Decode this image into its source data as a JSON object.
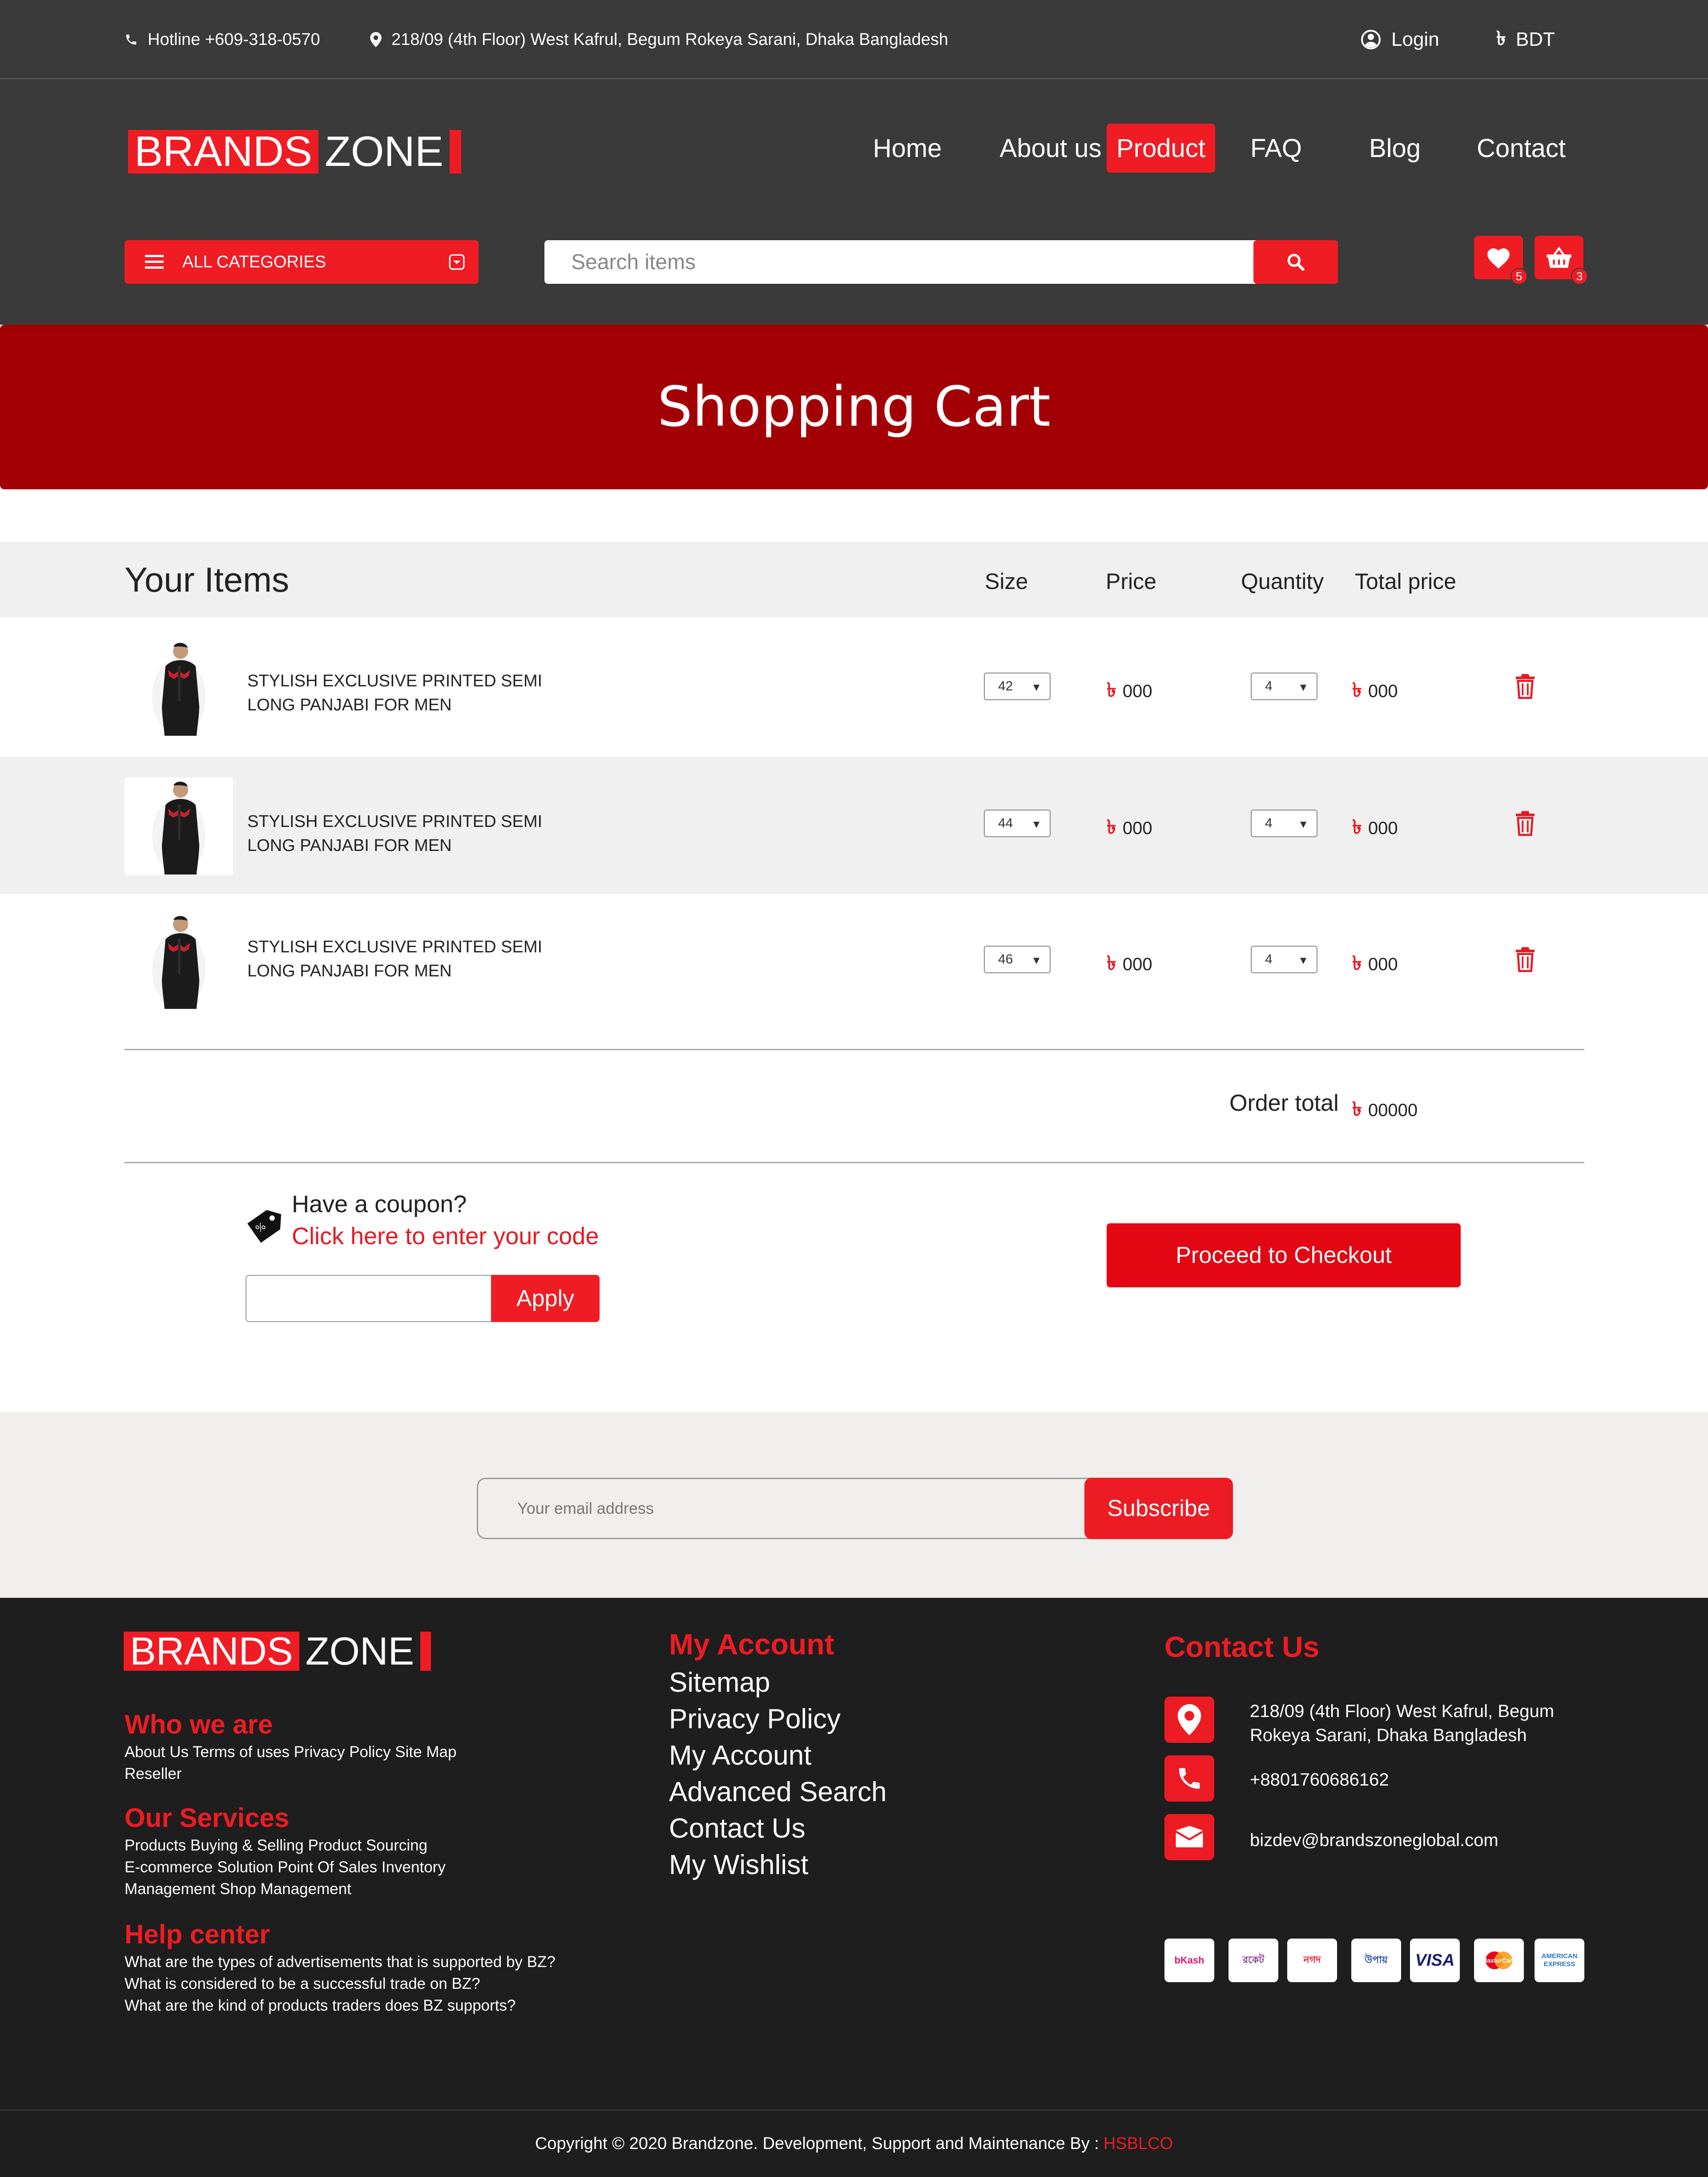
{
  "topbar": {
    "hotline": "Hotline +609-318-0570",
    "address": "218/09 (4th Floor) West Kafrul, Begum Rokeya Sarani, Dhaka Bangladesh",
    "login": "Login",
    "currency": "BDT"
  },
  "logo": {
    "brands": "BRANDS",
    "zone": "ZONE"
  },
  "nav": [
    "Home",
    "About us",
    "Product",
    "FAQ",
    "Blog",
    "Contact"
  ],
  "categories_label": "ALL CATEGORIES",
  "search": {
    "placeholder": "Search items"
  },
  "header_icons": {
    "wishlist_count": "5",
    "cart_count": "3"
  },
  "banner_title": "Shopping Cart",
  "table": {
    "title": "Your Items",
    "col_size": "Size",
    "col_price": "Price",
    "col_quantity": "Quantity",
    "col_total": "Total price"
  },
  "items": [
    {
      "name_line1": "STYLISH EXCLUSIVE PRINTED SEMI",
      "name_line2": "LONG PANJABI FOR MEN",
      "size": "42",
      "price": "000",
      "quantity": "4",
      "total": "000"
    },
    {
      "name_line1": "STYLISH EXCLUSIVE PRINTED SEMI",
      "name_line2": "LONG PANJABI FOR MEN",
      "size": "44",
      "price": "000",
      "quantity": "4",
      "total": "000"
    },
    {
      "name_line1": "STYLISH EXCLUSIVE PRINTED SEMI",
      "name_line2": "LONG PANJABI FOR MEN",
      "size": "46",
      "price": "000",
      "quantity": "4",
      "total": "000"
    }
  ],
  "currency_symbol": "৳",
  "order_total": {
    "label": "Order total",
    "value": "00000"
  },
  "coupon": {
    "question": "Have a coupon?",
    "link": "Click here to enter your code",
    "apply": "Apply"
  },
  "checkout": "Proceed to Checkout",
  "subscribe": {
    "placeholder": "Your email address",
    "button": "Subscribe"
  },
  "footer": {
    "who_title": "Who we are",
    "who_text_1": "About Us Terms of uses Privacy Policy Site Map",
    "who_text_2": "Reseller",
    "services_title": "Our Services",
    "services_text_1": "Products Buying & Selling Product Sourcing",
    "services_text_2": "E-commerce Solution Point Of Sales Inventory",
    "services_text_3": "Management Shop Management",
    "help_title": "Help center",
    "help_text_1": "What are the types of advertisements that is supported by BZ?",
    "help_text_2": "What is considered to be a successful trade on BZ?",
    "help_text_3": "What are the kind of products traders does BZ supports?",
    "account_title": "My Account",
    "account_links": [
      "Sitemap",
      "Privacy Policy",
      "My Account",
      "Advanced Search",
      "Contact Us",
      "My Wishlist"
    ],
    "contact_title": "Contact Us",
    "contact_address_1": "218/09 (4th Floor) West Kafrul, Begum",
    "contact_address_2": "Rokeya Sarani, Dhaka Bangladesh",
    "contact_phone": "+8801760686162",
    "contact_email": "bizdev@brandszoneglobal.com",
    "payments": [
      "bKash",
      "রকেট",
      "নগদ",
      "উপায়",
      "VISA",
      "MasterCard",
      "AMERICAN EXPRESS"
    ]
  },
  "copyright": {
    "text": "Copyright © 2020 Brandzone. Development, Support and Maintenance By :",
    "company": "HSBLCO"
  },
  "colors": {
    "brand_red": "#f01c24",
    "banner_red": "#a30006",
    "dark_bg": "#3a3a3a",
    "footer_bg": "#1e1e1e"
  }
}
